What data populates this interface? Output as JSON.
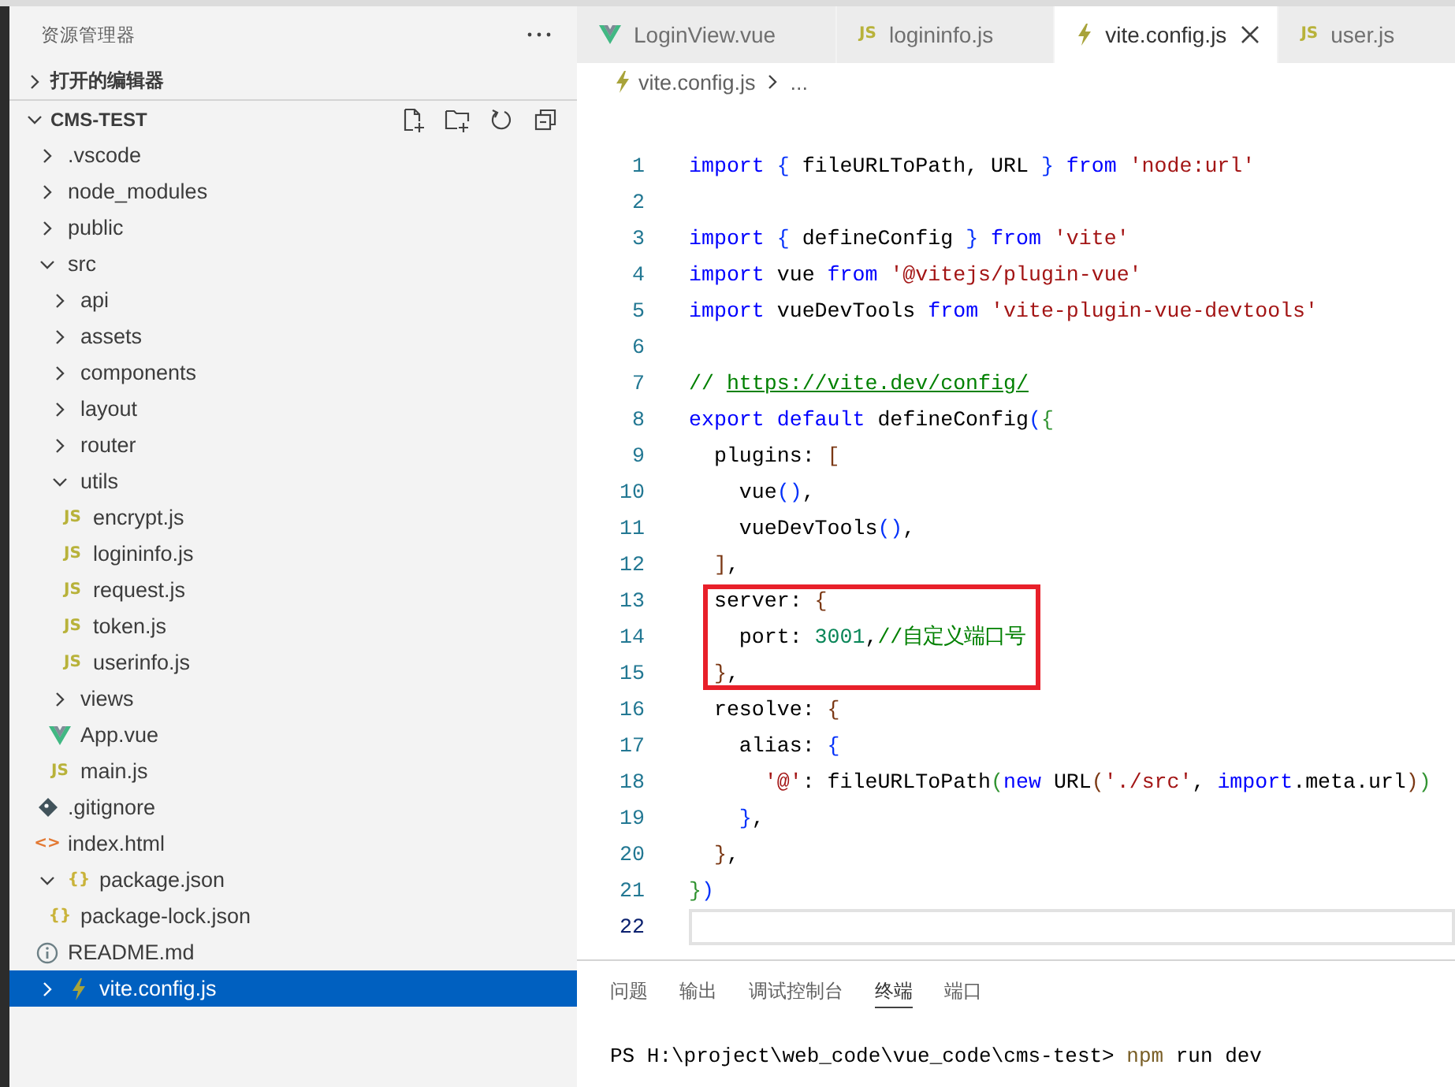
{
  "sidebar": {
    "title": "资源管理器",
    "sections": [
      {
        "label": "打开的编辑器",
        "expanded": false
      },
      {
        "label": "CMS-TEST",
        "expanded": true,
        "tree": [
          {
            "name": ".vscode",
            "kind": "folder",
            "expanded": false,
            "selected": false
          },
          {
            "name": "node_modules",
            "kind": "folder",
            "expanded": false,
            "selected": false
          },
          {
            "name": "public",
            "kind": "folder",
            "expanded": false,
            "selected": false
          },
          {
            "name": "src",
            "kind": "folder",
            "expanded": true,
            "selected": false,
            "children": [
              {
                "name": "api",
                "kind": "folder",
                "expanded": false,
                "selected": false
              },
              {
                "name": "assets",
                "kind": "folder",
                "expanded": false,
                "selected": false
              },
              {
                "name": "components",
                "kind": "folder",
                "expanded": false,
                "selected": false
              },
              {
                "name": "layout",
                "kind": "folder",
                "expanded": false,
                "selected": false
              },
              {
                "name": "router",
                "kind": "folder",
                "expanded": false,
                "selected": false
              },
              {
                "name": "utils",
                "kind": "folder",
                "expanded": true,
                "selected": false,
                "children": [
                  {
                    "name": "encrypt.js",
                    "kind": "js",
                    "icon_text": "JS",
                    "selected": false
                  },
                  {
                    "name": "logininfo.js",
                    "kind": "js",
                    "icon_text": "JS",
                    "selected": false
                  },
                  {
                    "name": "request.js",
                    "kind": "js",
                    "icon_text": "JS",
                    "selected": false
                  },
                  {
                    "name": "token.js",
                    "kind": "js",
                    "icon_text": "JS",
                    "selected": false
                  },
                  {
                    "name": "userinfo.js",
                    "kind": "js",
                    "icon_text": "JS",
                    "selected": false
                  }
                ]
              },
              {
                "name": "views",
                "kind": "folder",
                "expanded": false,
                "selected": false
              },
              {
                "name": "App.vue",
                "kind": "vue",
                "selected": false
              },
              {
                "name": "main.js",
                "kind": "js",
                "icon_text": "JS",
                "selected": false
              }
            ]
          },
          {
            "name": ".gitignore",
            "kind": "git",
            "selected": false
          },
          {
            "name": "index.html",
            "kind": "html",
            "icon_text": "<>",
            "selected": false
          },
          {
            "name": "package.json",
            "kind": "json",
            "icon_text": "{}",
            "expanded": true,
            "selected": false,
            "children": [
              {
                "name": "package-lock.json",
                "kind": "json",
                "icon_text": "{}",
                "selected": false
              }
            ]
          },
          {
            "name": "README.md",
            "kind": "info",
            "selected": false
          },
          {
            "name": "vite.config.js",
            "kind": "config",
            "expanded": false,
            "selected": true
          }
        ]
      }
    ]
  },
  "editor": {
    "tabs": [
      {
        "label": "LoginView.vue",
        "kind": "vue",
        "selected": false
      },
      {
        "label": "logininfo.js",
        "kind": "js",
        "icon_text": "JS",
        "selected": false
      },
      {
        "label": "vite.config.js",
        "kind": "config",
        "selected": true
      },
      {
        "label": "user.js",
        "kind": "js",
        "icon_text": "JS",
        "selected": false
      }
    ],
    "breadcrumb": {
      "kind": "config",
      "items": [
        "vite.config.js",
        "..."
      ]
    },
    "lines": [
      {
        "number": "1",
        "highlighted": false,
        "current": false,
        "tokens": [
          {
            "kind": "keyword",
            "text": "import "
          },
          {
            "kind": "bracket1",
            "text": "{"
          },
          {
            "kind": "plain",
            "text": " fileURLToPath, URL "
          },
          {
            "kind": "bracket1",
            "text": "} "
          },
          {
            "kind": "keyword",
            "text": "from "
          },
          {
            "kind": "string",
            "text": "'node:url'"
          }
        ]
      },
      {
        "number": "2",
        "highlighted": false,
        "current": false
      },
      {
        "number": "3",
        "highlighted": false,
        "current": false,
        "tokens": [
          {
            "kind": "keyword",
            "text": "import "
          },
          {
            "kind": "bracket1",
            "text": "{ "
          },
          {
            "kind": "plain",
            "text": "defineConfig "
          },
          {
            "kind": "bracket1",
            "text": "} "
          },
          {
            "kind": "keyword",
            "text": "from "
          },
          {
            "kind": "string",
            "text": "'vite'"
          }
        ]
      },
      {
        "number": "4",
        "highlighted": false,
        "current": false,
        "tokens": [
          {
            "kind": "keyword",
            "text": "import "
          },
          {
            "kind": "plain",
            "text": "vue "
          },
          {
            "kind": "keyword",
            "text": "from "
          },
          {
            "kind": "string",
            "text": "'@vitejs/plugin-vue'"
          }
        ]
      },
      {
        "number": "5",
        "highlighted": false,
        "current": false,
        "tokens": [
          {
            "kind": "keyword",
            "text": "import "
          },
          {
            "kind": "plain",
            "text": "vueDevTools "
          },
          {
            "kind": "keyword",
            "text": "from "
          },
          {
            "kind": "string",
            "text": "'vite-plugin-vue-devtools'"
          }
        ]
      },
      {
        "number": "6",
        "highlighted": false,
        "current": false
      },
      {
        "number": "7",
        "highlighted": false,
        "current": false,
        "tokens": [
          {
            "kind": "comment",
            "text": "// "
          },
          {
            "kind": "link",
            "text": "https://vite.dev/config/"
          }
        ]
      },
      {
        "number": "8",
        "highlighted": false,
        "current": false,
        "tokens": [
          {
            "kind": "keyword",
            "text": "export default "
          },
          {
            "kind": "plain",
            "text": "defineConfig"
          },
          {
            "kind": "bracket1",
            "text": "("
          },
          {
            "kind": "bracket2",
            "text": "{"
          }
        ]
      },
      {
        "number": "9",
        "highlighted": false,
        "current": false,
        "tokens": [
          {
            "kind": "plain",
            "text": "  plugins: "
          },
          {
            "kind": "bracket3",
            "text": "["
          }
        ]
      },
      {
        "number": "10",
        "highlighted": false,
        "current": false,
        "tokens": [
          {
            "kind": "plain",
            "text": "    vue"
          },
          {
            "kind": "bracket1",
            "text": "()"
          },
          {
            "kind": "plain",
            "text": ","
          }
        ]
      },
      {
        "number": "11",
        "highlighted": false,
        "current": false,
        "tokens": [
          {
            "kind": "plain",
            "text": "    vueDevTools"
          },
          {
            "kind": "bracket1",
            "text": "()"
          },
          {
            "kind": "plain",
            "text": ","
          }
        ]
      },
      {
        "number": "12",
        "highlighted": false,
        "current": false,
        "tokens": [
          {
            "kind": "bracket3",
            "text": "  ]"
          },
          {
            "kind": "plain",
            "text": ","
          }
        ]
      },
      {
        "number": "13",
        "highlighted": true,
        "current": false,
        "tokens": [
          {
            "kind": "plain",
            "text": "  server: "
          },
          {
            "kind": "bracket3",
            "text": "{"
          }
        ]
      },
      {
        "number": "14",
        "highlighted": true,
        "current": false,
        "tokens": [
          {
            "kind": "plain",
            "text": "    port: "
          },
          {
            "kind": "number",
            "text": "3001"
          },
          {
            "kind": "plain",
            "text": ","
          },
          {
            "kind": "comment",
            "text": "//自定义端口号"
          }
        ]
      },
      {
        "number": "15",
        "highlighted": true,
        "current": false,
        "tokens": [
          {
            "kind": "bracket3",
            "text": "  }"
          },
          {
            "kind": "plain",
            "text": ","
          }
        ]
      },
      {
        "number": "16",
        "highlighted": false,
        "current": false,
        "tokens": [
          {
            "kind": "plain",
            "text": "  resolve: "
          },
          {
            "kind": "bracket3",
            "text": "{"
          }
        ]
      },
      {
        "number": "17",
        "highlighted": false,
        "current": false,
        "tokens": [
          {
            "kind": "plain",
            "text": "    alias: "
          },
          {
            "kind": "bracket1",
            "text": "{"
          }
        ]
      },
      {
        "number": "18",
        "highlighted": false,
        "current": false,
        "tokens": [
          {
            "kind": "string",
            "text": "      '@'"
          },
          {
            "kind": "plain",
            "text": ": fileURLToPath"
          },
          {
            "kind": "bracket2",
            "text": "("
          },
          {
            "kind": "keyword",
            "text": "new "
          },
          {
            "kind": "plain",
            "text": "URL"
          },
          {
            "kind": "bracket3",
            "text": "("
          },
          {
            "kind": "string",
            "text": "'./src'"
          },
          {
            "kind": "plain",
            "text": ", "
          },
          {
            "kind": "keyword",
            "text": "import"
          },
          {
            "kind": "plain",
            "text": ".meta.url"
          },
          {
            "kind": "bracket3",
            "text": ")"
          },
          {
            "kind": "bracket2",
            "text": ")"
          }
        ]
      },
      {
        "number": "19",
        "highlighted": false,
        "current": false,
        "tokens": [
          {
            "kind": "bracket1",
            "text": "    }"
          },
          {
            "kind": "plain",
            "text": ","
          }
        ]
      },
      {
        "number": "20",
        "highlighted": false,
        "current": false,
        "tokens": [
          {
            "kind": "bracket3",
            "text": "  }"
          },
          {
            "kind": "plain",
            "text": ","
          }
        ]
      },
      {
        "number": "21",
        "highlighted": false,
        "current": false,
        "tokens": [
          {
            "kind": "bracket2",
            "text": "}"
          },
          {
            "kind": "bracket1",
            "text": ")"
          }
        ]
      },
      {
        "number": "22",
        "highlighted": false,
        "current": true
      }
    ]
  },
  "panel": {
    "tabs": [
      {
        "label": "问题",
        "selected": false
      },
      {
        "label": "输出",
        "selected": false
      },
      {
        "label": "调试控制台",
        "selected": false
      },
      {
        "label": "终端",
        "selected": true
      },
      {
        "label": "端口",
        "selected": false
      }
    ],
    "terminal": [
      {
        "kind": "plain",
        "text": "PS H:\\project\\web_code\\vue_code\\cms-test> "
      },
      {
        "kind": "command",
        "text": "npm"
      },
      {
        "kind": "plain",
        "text": " run dev"
      }
    ]
  }
}
